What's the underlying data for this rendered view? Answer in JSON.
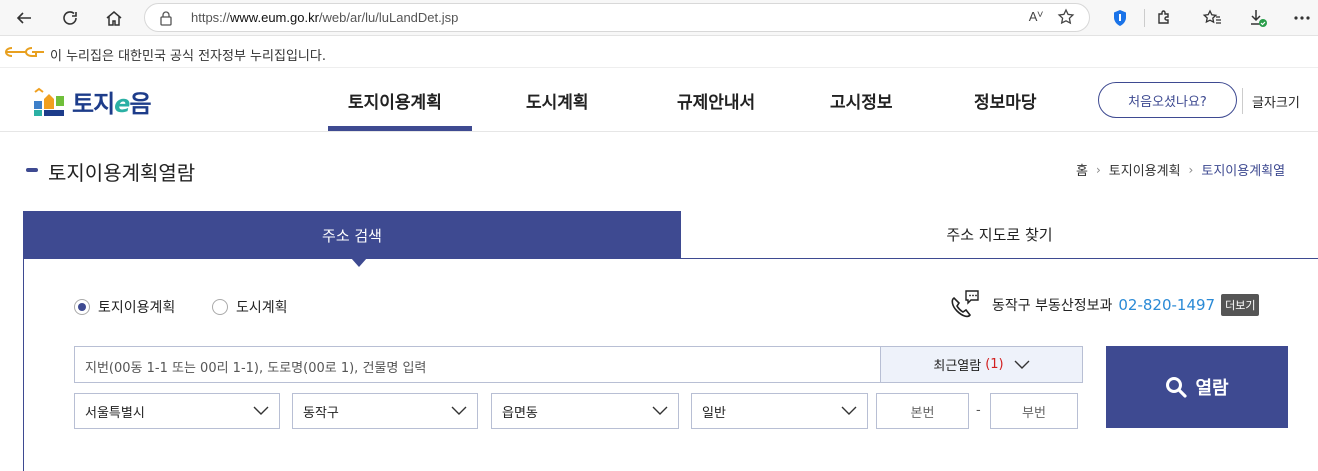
{
  "browser": {
    "url_prefix": "https://",
    "url_host": "www.eum.go.kr",
    "url_path": "/web/ar/lu/luLandDet.jsp",
    "read_aloud": "Aⱽ"
  },
  "gov_banner": {
    "text": "이 누리집은 대한민국 공식 전자정부 누리집입니다."
  },
  "header": {
    "brand": {
      "prefix": "토지",
      "e": "e",
      "suffix": "음"
    },
    "menu": [
      "토지이용계획",
      "도시계획",
      "규제안내서",
      "고시정보",
      "정보마당"
    ],
    "first_visit": "처음오셨나요?",
    "font_size": "글자크기"
  },
  "page": {
    "title": "토지이용계획열람",
    "breadcrumb": [
      "홈",
      "토지이용계획",
      "토지이용계획열"
    ]
  },
  "tabs": {
    "address_search": "주소 검색",
    "map_search": "주소 지도로 찾기"
  },
  "radios": [
    {
      "label": "토지이용계획",
      "checked": true
    },
    {
      "label": "도시계획",
      "checked": false
    }
  ],
  "contact": {
    "dept": "동작구 부동산정보과",
    "phone": "02-820-1497",
    "more": "더보기"
  },
  "search": {
    "placeholder": "지번(00동 1-1 또는 00리 1-1), 도로명(00로 1), 건물명 입력",
    "recent_label": "최근열람",
    "recent_count": "(1)",
    "view_button": "열람"
  },
  "selects": {
    "sido": "서울특별시",
    "sigungu": "동작구",
    "emd": "읍면동",
    "type": "일반"
  },
  "lot": {
    "main": "본번",
    "dash": "-",
    "sub": "부번"
  },
  "colors": {
    "primary": "#3e4a91",
    "phone": "#2a8ad6",
    "count": "#d21f1f"
  }
}
